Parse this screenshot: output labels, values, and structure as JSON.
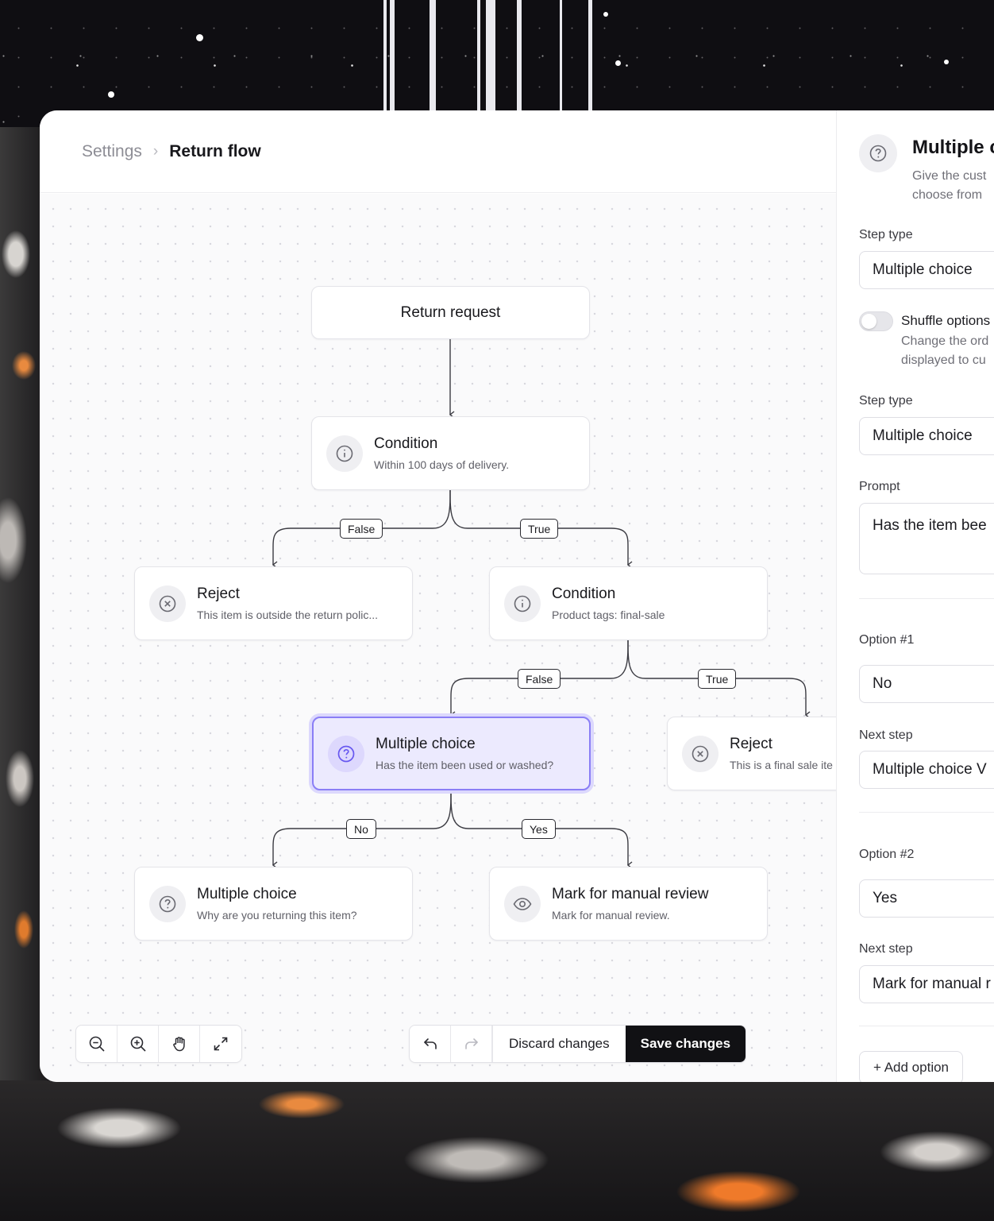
{
  "breadcrumb": {
    "root": "Settings",
    "separator": "›",
    "current": "Return flow"
  },
  "nodes": {
    "start": {
      "title": "Return request"
    },
    "cond1": {
      "title": "Condition",
      "sub": "Within 100 days of delivery.",
      "icon": "info-icon"
    },
    "reject1": {
      "title": "Reject",
      "sub": "This item is outside the return polic...",
      "icon": "x-circle-icon"
    },
    "cond2": {
      "title": "Condition",
      "sub": "Product tags: final-sale",
      "icon": "info-icon"
    },
    "mc1": {
      "title": "Multiple choice",
      "sub": "Has the item been used or washed?",
      "icon": "question-icon",
      "selected": true
    },
    "reject2": {
      "title": "Reject",
      "sub": "This is a final sale ite",
      "icon": "x-circle-icon"
    },
    "mc2": {
      "title": "Multiple choice",
      "sub": "Why are you returning this item?",
      "icon": "question-icon"
    },
    "review": {
      "title": "Mark for manual review",
      "sub": "Mark for manual review.",
      "icon": "eye-icon"
    }
  },
  "edge_labels": {
    "c1_false": "False",
    "c1_true": "True",
    "c2_false": "False",
    "c2_true": "True",
    "m1_no": "No",
    "m1_yes": "Yes"
  },
  "toolbar": {
    "zoom_out_icon": "zoom-out-icon",
    "zoom_in_icon": "zoom-in-icon",
    "pan_icon": "hand-icon",
    "fit_icon": "expand-icon",
    "undo_icon": "undo-icon",
    "redo_icon": "redo-icon",
    "discard": "Discard changes",
    "save": "Save changes"
  },
  "panel": {
    "title": "Multiple c",
    "description": "Give the cust choose from",
    "step_type_label": "Step type",
    "step_type_value": "Multiple choice",
    "shuffle_title": "Shuffle options",
    "shuffle_desc": "Change the ord displayed to cu",
    "shuffle_on": false,
    "step_type2_label": "Step type",
    "step_type2_value": "Multiple choice",
    "prompt_label": "Prompt",
    "prompt_value": "Has the item bee",
    "option1_label": "Option #1",
    "option1_value": "No",
    "next1_label": "Next step",
    "next1_value": "Multiple choice  V",
    "option2_label": "Option #2",
    "option2_value": "Yes",
    "next2_label": "Next step",
    "next2_value": "Mark for manual r",
    "add_option": "+ Add option"
  },
  "colors": {
    "accent": "#8a7ef6",
    "selected_bg": "#eceafe",
    "save_bg": "#111114"
  }
}
